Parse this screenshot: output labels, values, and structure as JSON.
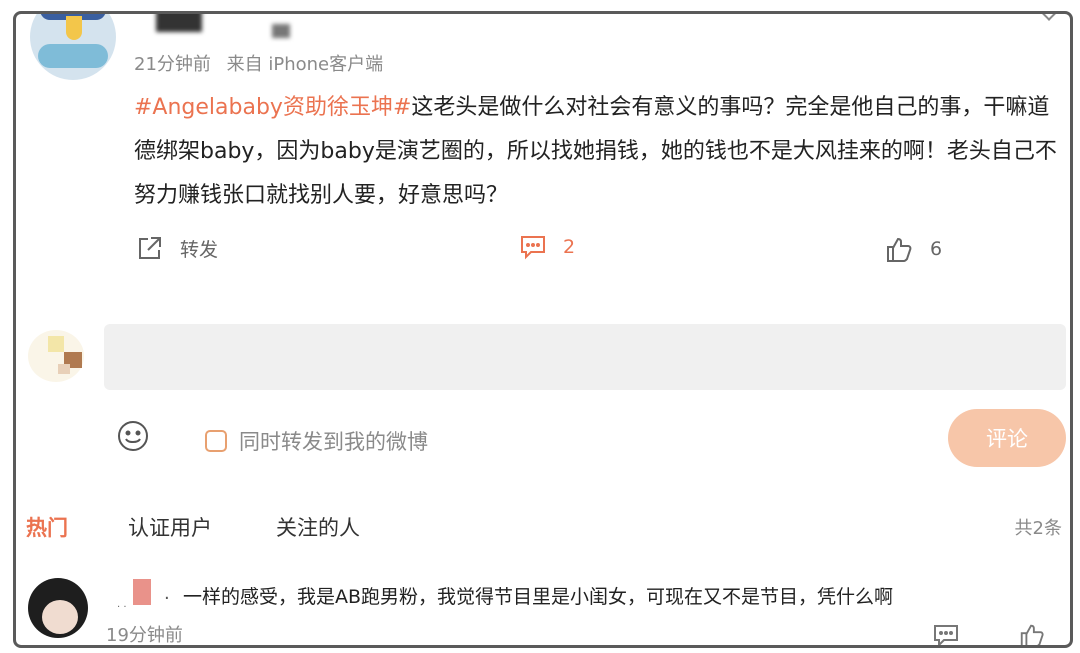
{
  "post": {
    "meta_time": "21分钟前",
    "meta_source": "来自 iPhone客户端",
    "hashtag": "#Angelababy资助徐玉坤#",
    "body": "这老头是做什么对社会有意义的事吗？完全是他自己的事，干嘛道德绑架baby，因为baby是演艺圈的，所以找她捐钱，她的钱也不是大风挂来的啊！老头自己不努力赚钱张口就找别人要，好意思吗？"
  },
  "actions": {
    "repost_label": "转发",
    "comment_count": "2",
    "like_count": "6"
  },
  "reply_box": {
    "repost_option_label": "同时转发到我的微博",
    "submit_label": "评论"
  },
  "tabs": {
    "items": [
      "热门",
      "认证用户",
      "关注的人"
    ],
    "active": "热门",
    "total_label": "共2条"
  },
  "comments": [
    {
      "text": "一样的感受，我是AB跑男粉，我觉得节目里是小闺女，可现在又不是节目，凭什么啊",
      "time": "19分钟前"
    }
  ],
  "colors": {
    "accent": "#eb7350",
    "submit_bg": "#f7c6a9",
    "input_bg": "#f0f0f0",
    "muted_text": "#8a8a8a"
  },
  "icons": {
    "repost": "share-arrow-icon",
    "comment": "comment-bubble-icon",
    "like": "thumbs-up-icon",
    "emoji": "smiley-icon"
  }
}
